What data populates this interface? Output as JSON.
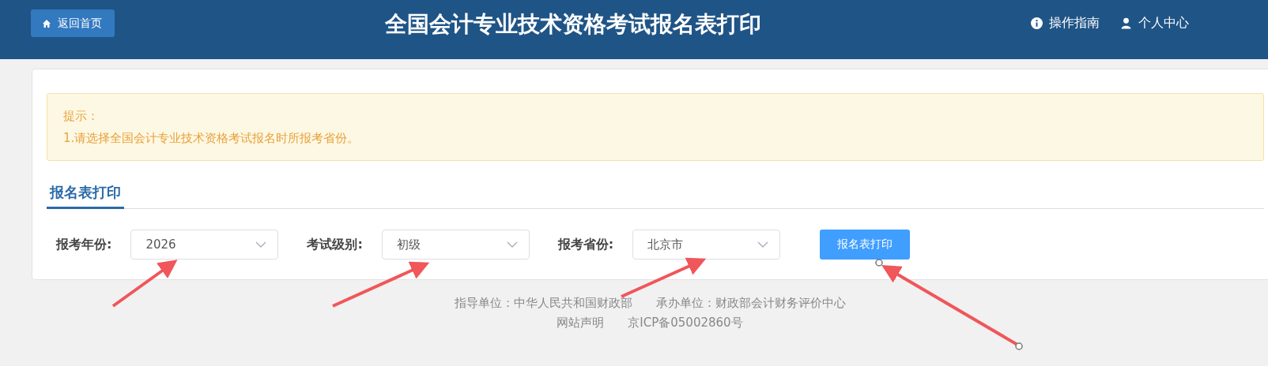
{
  "header": {
    "home_button": "返回首页",
    "title": "全国会计专业技术资格考试报名表打印",
    "links": [
      {
        "kind": "guide",
        "label": "操作指南"
      },
      {
        "kind": "user",
        "label": "个人中心"
      }
    ]
  },
  "notice": {
    "title": "提示：",
    "lines": [
      "1.请选择全国会计专业技术资格考试报名时所报考省份。"
    ]
  },
  "tabs": [
    {
      "label": "报名表打印",
      "selected": true
    }
  ],
  "form": {
    "fields": [
      {
        "label": "报考年份:",
        "value": "2026"
      },
      {
        "label": "考试级别:",
        "value": "初级"
      },
      {
        "label": "报考省份:",
        "value": "北京市"
      }
    ],
    "submit": "报名表打印"
  },
  "footer": {
    "lines": [
      [
        "指导单位：中华人民共和国财政部",
        "承办单位：财政部会计财务评价中心"
      ],
      [
        "网站声明",
        "京ICP备05002860号"
      ]
    ]
  }
}
